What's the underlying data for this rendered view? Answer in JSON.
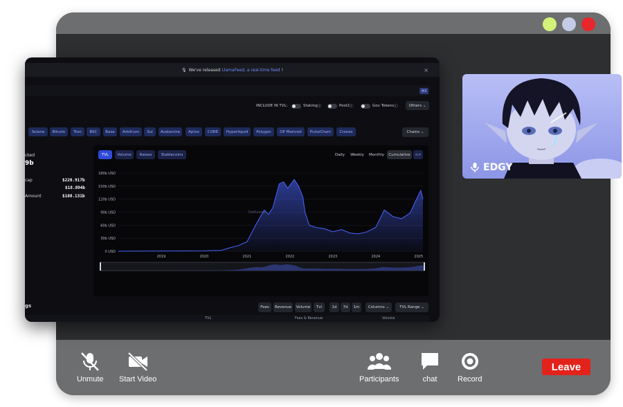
{
  "window": {
    "dots": [
      "#d4f27a",
      "#c3cbe6",
      "#e8262b"
    ]
  },
  "share": {
    "banner": {
      "prefix": "We've released",
      "link": "LlamaFeed, a real-time feed",
      "suffix": "!",
      "close": "×"
    },
    "search_kbd": "⌘K",
    "include_tvl": "INCLUDE IN TVL:",
    "toggles": [
      "Staking",
      "Pool2",
      "Gov Tokens"
    ],
    "others": "Others",
    "chains": [
      "Solana",
      "Bitcoin",
      "Tron",
      "BSC",
      "Base",
      "Arbitrum",
      "Sui",
      "Avalanche",
      "Aptos",
      "CORE",
      "Hyperliquid",
      "Polygon",
      "OP Mainnet",
      "PulseChain",
      "Cronos"
    ],
    "chains_dropdown": "Chains",
    "stats": {
      "locked_label": "cked",
      "locked_value": "9b",
      "mcap_label": "cap",
      "mcap_value": "$220.917b",
      "second_value": "$18.894b",
      "amount_label": "Amount",
      "amount_value": "$108.131b"
    },
    "chart_tabs": [
      "TVL",
      "Volume",
      "Raises",
      "Stablecoins"
    ],
    "granularity": [
      "Daily",
      "Weekly",
      "Monthly",
      "Cumulative"
    ],
    "code_btn": "<>",
    "watermark": "DefiLlama",
    "bottom_label": "gs",
    "bottom_buttons": [
      "Fees",
      "Revenue",
      "Volume",
      "Tvl",
      "1d",
      "7d",
      "1m",
      "Columns",
      "TVL Range"
    ],
    "table_headers": [
      "TVL",
      "Fees & Revenue",
      "Volume"
    ]
  },
  "chart_data": {
    "type": "area",
    "yticks": [
      "180b USD",
      "150b USD",
      "120b USD",
      "90b USD",
      "60b USD",
      "30b USD",
      "0 USD"
    ],
    "xticks": [
      "2019",
      "2020",
      "2021",
      "2022",
      "2023",
      "2024",
      "2025"
    ],
    "ylim": [
      0,
      180
    ],
    "x": [
      2018.0,
      2018.5,
      2019.0,
      2019.5,
      2020.0,
      2020.4,
      2020.6,
      2020.8,
      2021.0,
      2021.2,
      2021.4,
      2021.5,
      2021.6,
      2021.75,
      2021.85,
      2021.95,
      2022.1,
      2022.2,
      2022.3,
      2022.35,
      2022.45,
      2022.6,
      2022.8,
      2023.0,
      2023.2,
      2023.4,
      2023.6,
      2023.8,
      2024.0,
      2024.2,
      2024.4,
      2024.6,
      2024.8,
      2024.95,
      2025.05,
      2025.1
    ],
    "values": [
      0,
      0.3,
      0.5,
      0.8,
      1,
      2,
      8,
      13,
      22,
      60,
      95,
      85,
      100,
      155,
      160,
      145,
      165,
      150,
      125,
      90,
      60,
      55,
      52,
      45,
      50,
      42,
      40,
      45,
      55,
      95,
      80,
      75,
      88,
      120,
      140,
      120
    ],
    "series_color": "#4a64ff"
  },
  "video": {
    "name": "EDGY"
  },
  "controls": {
    "unmute": "Unmute",
    "start_video": "Start Video",
    "participants": "Participants",
    "chat": "chat",
    "record": "Record",
    "leave": "Leave"
  }
}
